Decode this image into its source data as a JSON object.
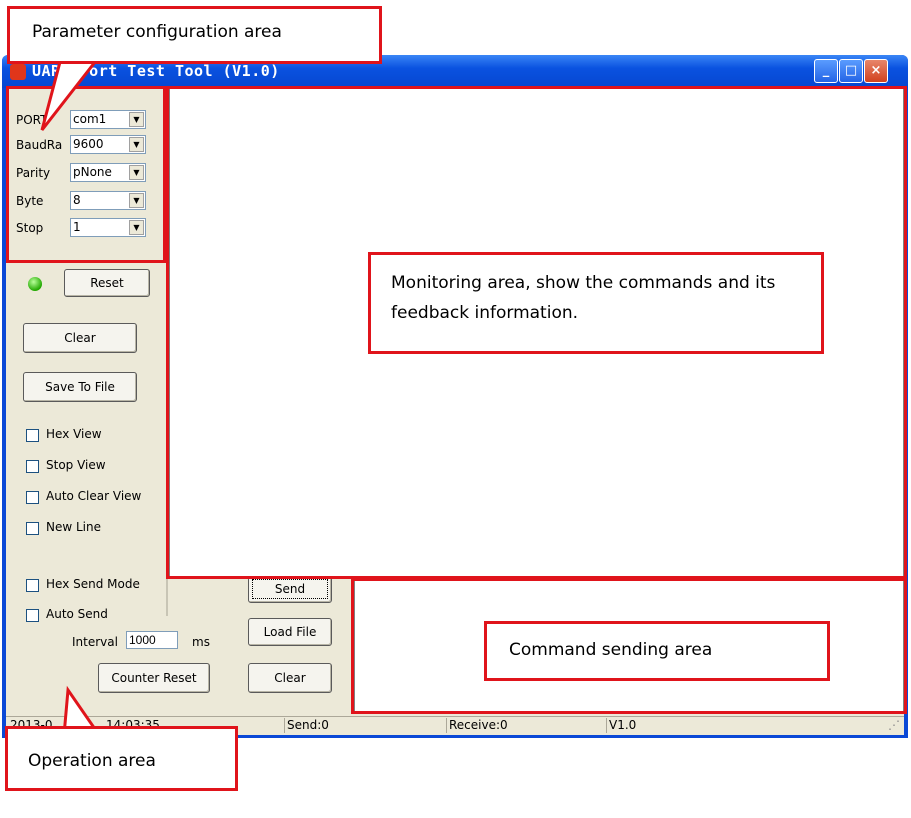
{
  "window": {
    "title": "UART Port Test Tool (V1.0)",
    "minimize_glyph": "_",
    "maximize_glyph": "□",
    "close_glyph": "×"
  },
  "config": {
    "port_label": "PORT",
    "port_value": "com1",
    "baud_label": "BaudRa",
    "baud_value": "9600",
    "parity_label": "Parity",
    "parity_value": "pNone",
    "byte_label": "Byte",
    "byte_value": "8",
    "stop_label": "Stop",
    "stop_value": "1",
    "reset_label": "Reset"
  },
  "operation": {
    "clear_label": "Clear",
    "save_label": "Save To File",
    "hex_view": "Hex View",
    "stop_view": "Stop View",
    "auto_clear_view": "Auto Clear View",
    "new_line": "New Line",
    "hex_send_mode": "Hex Send Mode",
    "auto_send": "Auto Send",
    "interval_label": "Interval",
    "interval_value": "1000",
    "interval_unit": "ms",
    "counter_reset": "Counter Reset"
  },
  "send_buttons": {
    "send": "Send",
    "load_file": "Load File",
    "clear": "Clear"
  },
  "statusbar": {
    "datetime": "2013-0",
    "time": "14:03:35",
    "send": "Send:0",
    "receive": "Receive:0",
    "version": "V1.0"
  },
  "annotations": {
    "parameter": "Parameter configuration area",
    "monitoring": "Monitoring area, show the commands and its feedback information.",
    "command": "Command sending area",
    "operation": "Operation area"
  },
  "colors": {
    "annotation_red": "#e0141b",
    "titlebar_blue": "#0a52e0",
    "led_green": "#22a800"
  }
}
